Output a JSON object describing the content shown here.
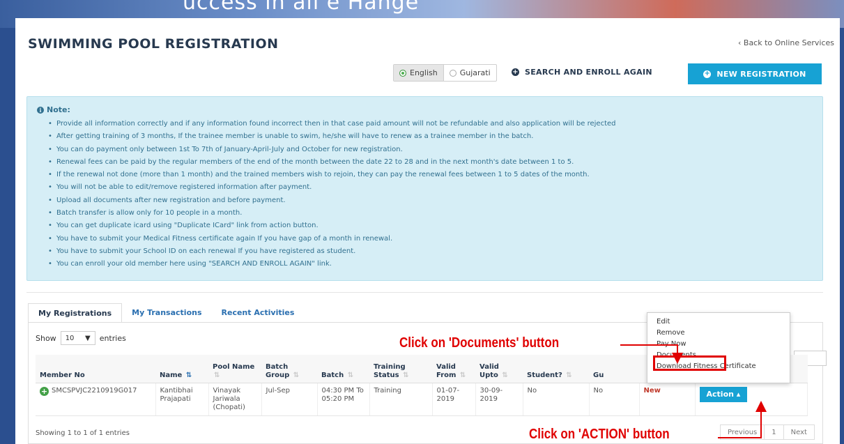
{
  "banner": {
    "partial_text": "uccess in all e Hange"
  },
  "page": {
    "title": "SWIMMING POOL REGISTRATION",
    "back_link": "‹ Back to Online Services"
  },
  "language": {
    "options": [
      "English",
      "Gujarati"
    ],
    "selected": "English"
  },
  "buttons": {
    "search_enroll": "SEARCH AND ENROLL AGAIN",
    "new_registration": "NEW REGISTRATION"
  },
  "note": {
    "title": "Note:",
    "items": [
      "Provide all information correctly and if any information found incorrect then in that case paid amount will not be refundable and also application will be rejected",
      "After getting training of 3 months, If the trainee member is unable to swim, he/she will have to renew as a trainee member in the batch.",
      "You can do payment only between 1st To 7th of January-April-July and October for new registration.",
      "Renewal fees can be paid by the regular members of the end of the month between the date 22 to 28 and in the next month's date between 1 to 5.",
      "If the renewal not done (more than 1 month) and the trained members wish to rejoin, they can pay the renewal fees between 1 to 5 dates of the month.",
      "You will not be able to edit/remove registered information after payment.",
      "Upload all documents after new registration and before payment.",
      "Batch transfer is allow only for 10 people in a month.",
      "You can get duplicate icard using \"Duplicate ICard\" link from action button.",
      "You have to submit your Medical Fitness certificate again If you have gap of a month in renewal.",
      "You have to submit your School ID on each renewal If you have registered as student.",
      "You can enroll your old member here using \"SEARCH AND ENROLL AGAIN\" link."
    ]
  },
  "tabs": [
    "My Registrations",
    "My Transactions",
    "Recent Activities"
  ],
  "table": {
    "show_label": "Show",
    "entries_value": "10",
    "entries_label": "entries",
    "headers": [
      "Member No",
      "Name",
      "Pool Name",
      "Batch Group",
      "Batch",
      "Training Status",
      "Valid From",
      "Valid Upto",
      "Student?",
      "Gu",
      "",
      ""
    ],
    "row": {
      "member_no": "SMCSPVJC2210919G017",
      "name": "Kantibhai Prajapati",
      "pool_name": "Vinayak Jariwala (Chopati)",
      "batch_group": "Jul-Sep",
      "batch": "04:30 PM To 05:20 PM",
      "training_status": "Training",
      "valid_from": "01-07-2019",
      "valid_upto": "30-09-2019",
      "student": "No",
      "gu": "No",
      "status": "New",
      "action": "Action"
    },
    "showing": "Showing 1 to 1 of 1 entries",
    "pagination": [
      "Previous",
      "1",
      "Next"
    ]
  },
  "action_menu": [
    "Edit",
    "Remove",
    "Pay Now",
    "Documents",
    "Download Fitness Certificate"
  ],
  "annotations": {
    "documents": "Click on 'Documents' button",
    "action": "Click on 'ACTION' button"
  },
  "colors": {
    "accent": "#17a2d4",
    "annotation": "#e00000",
    "note_bg": "#d6eef6",
    "title": "#27394f"
  }
}
